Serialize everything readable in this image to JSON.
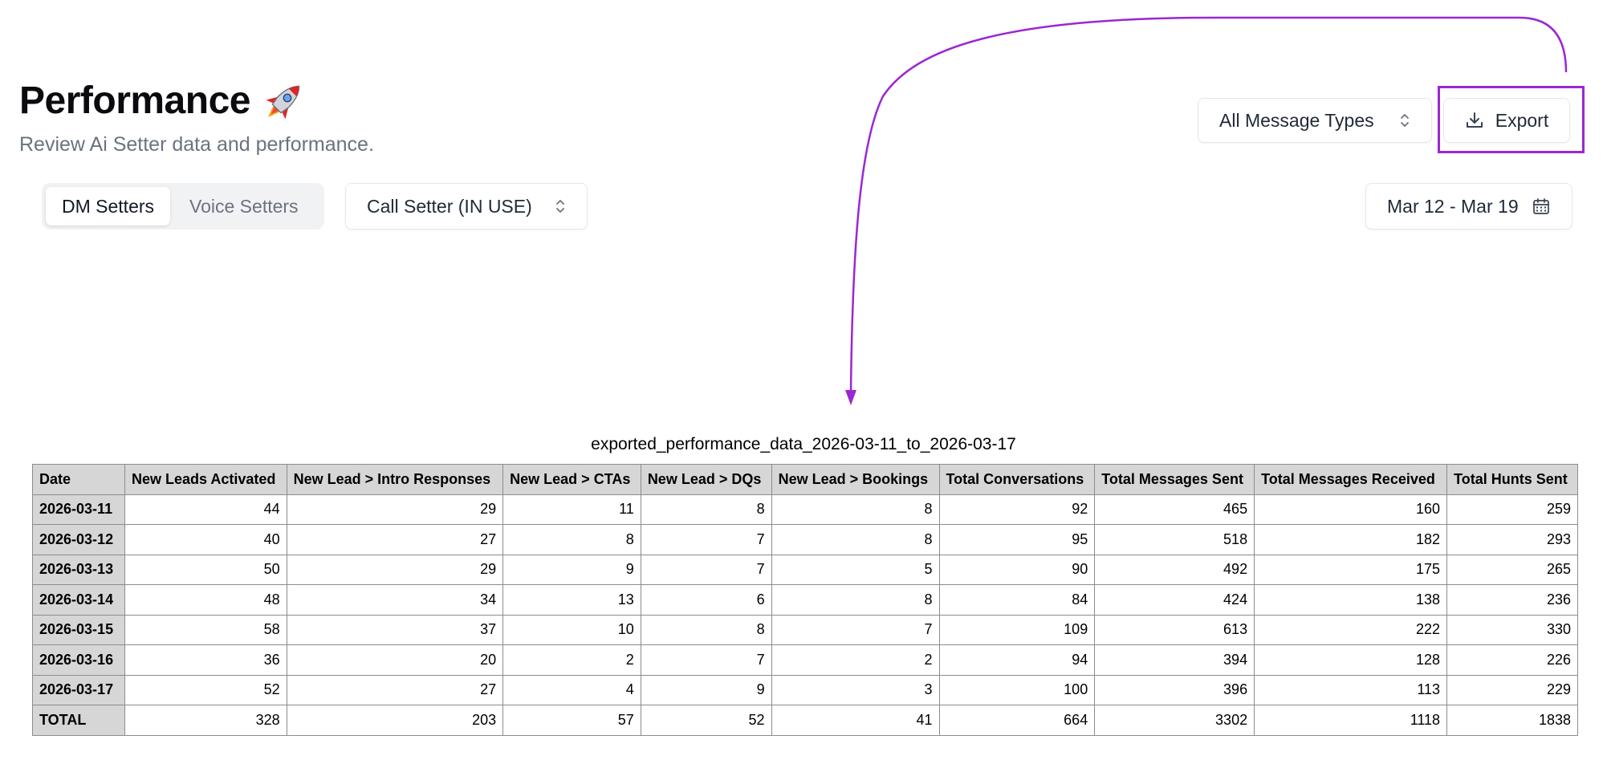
{
  "header": {
    "title": "Performance",
    "title_emoji": "rocket",
    "subtitle": "Review Ai Setter data and performance."
  },
  "toolbar": {
    "message_types_label": "All Message Types",
    "export_label": "Export"
  },
  "tabs": [
    {
      "label": "DM Setters",
      "active": true
    },
    {
      "label": "Voice Setters",
      "active": false
    }
  ],
  "setter_select": {
    "value": "Call Setter (IN USE)"
  },
  "date_range": {
    "label": "Mar 12 - Mar 19"
  },
  "annotation": {
    "color": "#9b27d4"
  },
  "export_table": {
    "caption": "exported_performance_data_2026-03-11_to_2026-03-17",
    "columns": [
      "Date",
      "New Leads Activated",
      "New Lead > Intro Responses",
      "New Lead > CTAs",
      "New Lead > DQs",
      "New Lead > Bookings",
      "Total Conversations",
      "Total Messages Sent",
      "Total Messages Received",
      "Total Hunts Sent"
    ],
    "rows": [
      [
        "2026-03-11",
        "44",
        "29",
        "11",
        "8",
        "8",
        "92",
        "465",
        "160",
        "259"
      ],
      [
        "2026-03-12",
        "40",
        "27",
        "8",
        "7",
        "8",
        "95",
        "518",
        "182",
        "293"
      ],
      [
        "2026-03-13",
        "50",
        "29",
        "9",
        "7",
        "5",
        "90",
        "492",
        "175",
        "265"
      ],
      [
        "2026-03-14",
        "48",
        "34",
        "13",
        "6",
        "8",
        "84",
        "424",
        "138",
        "236"
      ],
      [
        "2026-03-15",
        "58",
        "37",
        "10",
        "8",
        "7",
        "109",
        "613",
        "222",
        "330"
      ],
      [
        "2026-03-16",
        "36",
        "20",
        "2",
        "7",
        "2",
        "94",
        "394",
        "128",
        "226"
      ],
      [
        "2026-03-17",
        "52",
        "27",
        "4",
        "9",
        "3",
        "100",
        "396",
        "113",
        "229"
      ],
      [
        "TOTAL",
        "328",
        "203",
        "57",
        "52",
        "41",
        "664",
        "3302",
        "1118",
        "1838"
      ]
    ]
  }
}
